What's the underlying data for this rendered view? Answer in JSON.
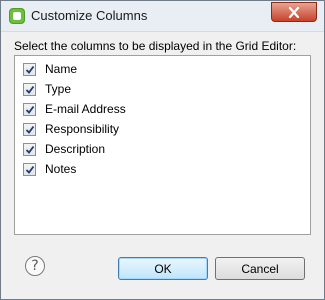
{
  "window": {
    "title": "Customize Columns"
  },
  "dialog": {
    "instruction": "Select the columns to be displayed in the Grid Editor:",
    "columns": [
      {
        "label": "Name",
        "checked": true
      },
      {
        "label": "Type",
        "checked": true
      },
      {
        "label": "E-mail Address",
        "checked": true
      },
      {
        "label": "Responsibility",
        "checked": true
      },
      {
        "label": "Description",
        "checked": true
      },
      {
        "label": "Notes",
        "checked": true
      }
    ]
  },
  "buttons": {
    "ok_label": "OK",
    "cancel_label": "Cancel",
    "help_glyph": "?"
  },
  "icons": {
    "app": "app-icon",
    "close": "close-icon",
    "help": "help-icon",
    "check": "checkmark-icon"
  },
  "colors": {
    "close_button": "#c7432b",
    "ok_border": "#3c7fb1",
    "check": "#1f3a73"
  }
}
